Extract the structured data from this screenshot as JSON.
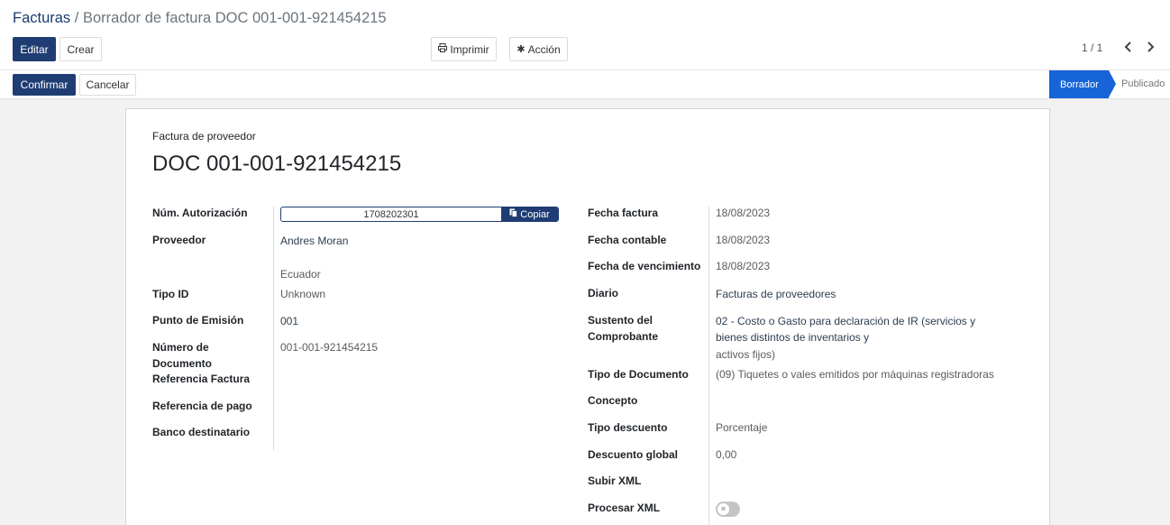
{
  "breadcrumb": {
    "parent": "Facturas",
    "separator": "/",
    "current": "Borrador de factura DOC 001-001-921454215"
  },
  "toolbar": {
    "edit_label": "Editar",
    "create_label": "Crear",
    "print_label": "Imprimir",
    "action_label": "Acción",
    "print_icon": "printer-icon",
    "action_icon": "gear-icon"
  },
  "pager": {
    "value": "1 / 1"
  },
  "statusbar": {
    "confirm_label": "Confirmar",
    "cancel_label": "Cancelar",
    "stages": [
      "Borrador",
      "Publicado"
    ],
    "active_stage": "Borrador"
  },
  "form": {
    "doc_type": "Factura de proveedor",
    "title": "DOC 001-001-921454215",
    "left": {
      "auth_label": "Núm. Autorización",
      "auth_value": "1708202301",
      "copy_label": "Copiar",
      "vendor_label": "Proveedor",
      "vendor_value": "Andres Moran",
      "vendor_country": "Ecuador",
      "id_type_label": "Tipo ID",
      "id_type_value": "Unknown",
      "emission_label": "Punto de Emisión",
      "emission_value": "001",
      "docnum_label_1": "Número de",
      "docnum_label_2": "Documento",
      "docnum_value": "001-001-921454215",
      "invref_label": "Referencia Factura",
      "payref_label": "Referencia de pago",
      "bank_label": "Banco destinatario"
    },
    "right": {
      "inv_date_label": "Fecha factura",
      "inv_date_value": "18/08/2023",
      "acc_date_label": "Fecha contable",
      "acc_date_value": "18/08/2023",
      "due_date_label": "Fecha de vencimiento",
      "due_date_value": "18/08/2023",
      "journal_label": "Diario",
      "journal_value": "Facturas de proveedores",
      "support_label_1": "Sustento del",
      "support_label_2": "Comprobante",
      "support_value_1": "02 - Costo o Gasto para declaración de IR (servicios y",
      "support_value_2": "bienes distintos de inventarios y",
      "support_value_3": "activos fijos)",
      "doctype_label": "Tipo de Documento",
      "doctype_value": "(09) Tiquetes o vales emitidos por máquinas registradoras",
      "concept_label": "Concepto",
      "disc_type_label": "Tipo descuento",
      "disc_type_value": "Porcentaje",
      "global_disc_label": "Descuento global",
      "global_disc_value": "0,00",
      "upload_xml_label": "Subir XML",
      "process_xml_label": "Procesar XML",
      "process_xml_on": false
    }
  },
  "colors": {
    "primary": "#1f3d73",
    "active_stage": "#1764d8"
  }
}
